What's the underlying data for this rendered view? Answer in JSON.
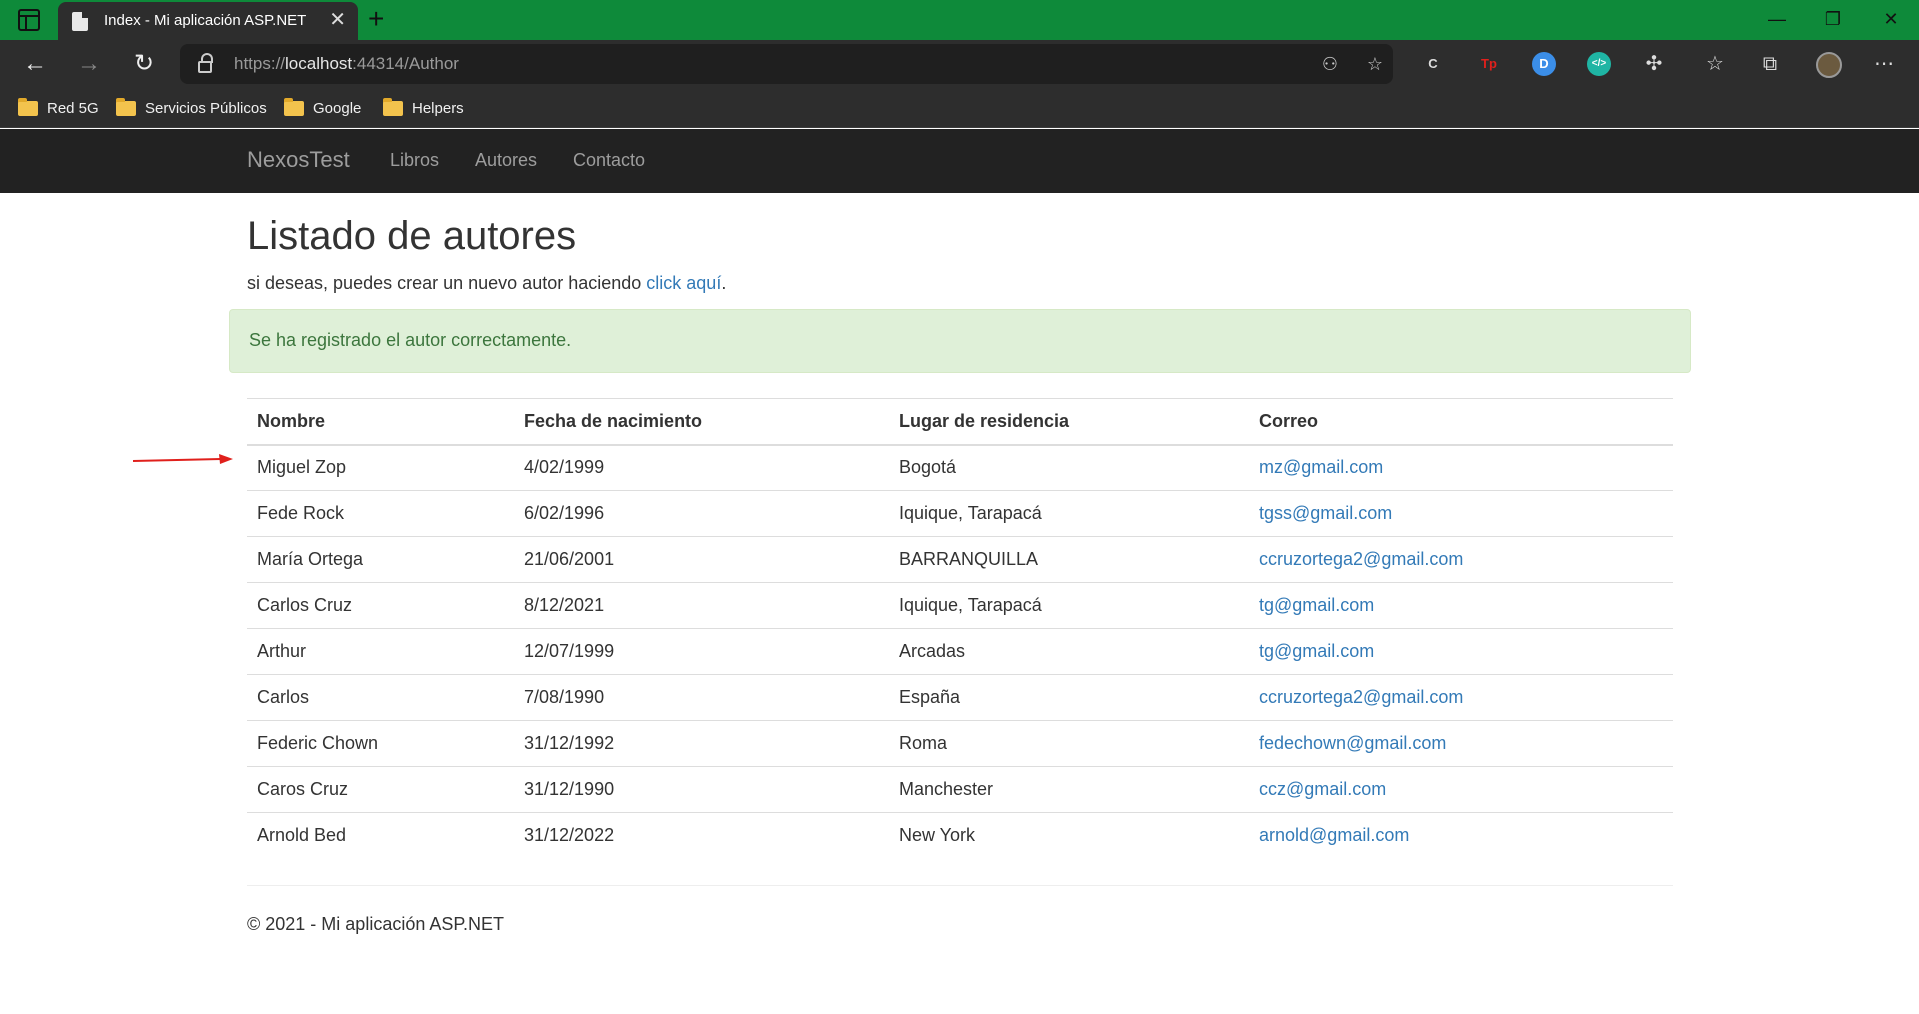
{
  "browser": {
    "tab_title": "Index - Mi aplicación ASP.NET",
    "tab_close": "✕",
    "new_tab": "+",
    "url_scheme": "https://",
    "url_host": "localhost",
    "url_path": ":44314/Author",
    "bookmarks": [
      "Red 5G",
      "Servicios Públicos",
      "Google",
      "Helpers"
    ],
    "extensions": [
      "C",
      "Tp",
      "D",
      "</>"
    ]
  },
  "navbar": {
    "brand": "NexosTest",
    "links": [
      "Libros",
      "Autores",
      "Contacto"
    ]
  },
  "main": {
    "title": "Listado de autores",
    "intro_text": "si deseas, puedes crear un nuevo autor haciendo ",
    "intro_link": "click aquí",
    "intro_end": ".",
    "alert": "Se ha registrado el autor correctamente."
  },
  "table": {
    "headers": [
      "Nombre",
      "Fecha de nacimiento",
      "Lugar de residencia",
      "Correo"
    ],
    "rows": [
      [
        "Miguel Zop",
        "4/02/1999",
        "Bogotá",
        "mz@gmail.com"
      ],
      [
        "Fede Rock",
        "6/02/1996",
        "Iquique, Tarapacá",
        "tgss@gmail.com"
      ],
      [
        "María Ortega",
        "21/06/2001",
        "BARRANQUILLA",
        "ccruzortega2@gmail.com"
      ],
      [
        "Carlos Cruz",
        "8/12/2021",
        "Iquique, Tarapacá",
        "tg@gmail.com"
      ],
      [
        "Arthur",
        "12/07/1999",
        "Arcadas",
        "tg@gmail.com"
      ],
      [
        "Carlos",
        "7/08/1990",
        "España",
        "ccruzortega2@gmail.com"
      ],
      [
        "Federic Chown",
        "31/12/1992",
        "Roma",
        "fedechown@gmail.com"
      ],
      [
        "Caros Cruz",
        "31/12/1990",
        "Manchester",
        "ccz@gmail.com"
      ],
      [
        "Arnold Bed",
        "31/12/2022",
        "New York",
        "arnold@gmail.com"
      ]
    ]
  },
  "footer": "© 2021 - Mi aplicación ASP.NET",
  "colors": {
    "tabbar": "#0e8a3a",
    "navbar": "#222222",
    "link": "#337ab7",
    "alert_bg": "#dff0d8",
    "annotation_arrow": "#e0201c"
  }
}
